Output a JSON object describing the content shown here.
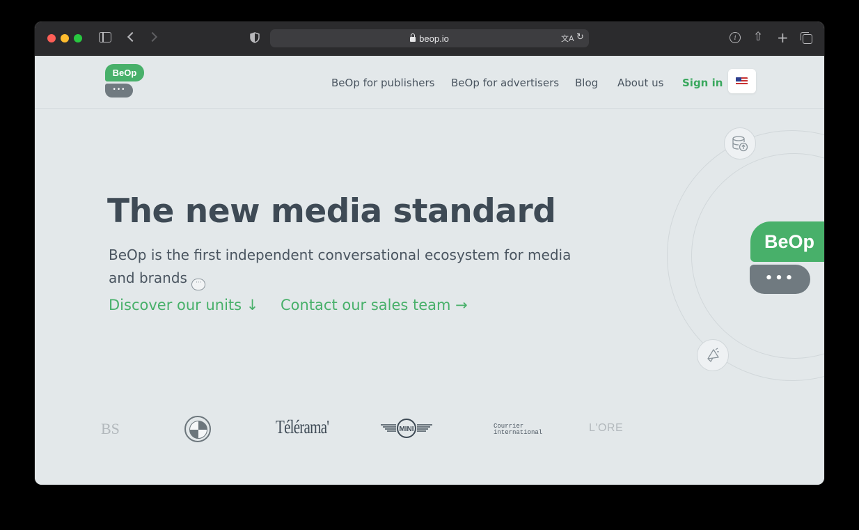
{
  "browser": {
    "url": "beop.io",
    "icons": [
      "sidebar-icon",
      "back-icon",
      "forward-icon",
      "shield-icon",
      "lock-icon",
      "translate-icon",
      "reload-icon",
      "info-icon",
      "share-icon",
      "new-tab-icon",
      "tabs-overview-icon"
    ]
  },
  "header": {
    "logo_text": "BeOp",
    "nav": {
      "publishers": "BeOp for publishers",
      "advertisers": "BeOp for advertisers",
      "blog": "Blog",
      "about": "About us",
      "signin": "Sign in"
    },
    "language_flag": "us-flag-icon"
  },
  "hero": {
    "title": "The new media standard",
    "subtitle": "BeOp is the first independent conversational ecosystem for media and brands",
    "cta_discover": "Discover our units ↓",
    "cta_contact": "Contact our sales team →"
  },
  "decor": {
    "bubble_text": "BeOp",
    "dots": "•••"
  },
  "brands": {
    "bs": "BS",
    "telerama": "Télérama'",
    "mini": "MINI",
    "courrier_1": "Courrier",
    "courrier_2": "international",
    "loreal": "L'ORE"
  },
  "colors": {
    "accent_green": "#48b06a",
    "text_dark": "#3e4a55",
    "background": "#e3e8ea"
  }
}
